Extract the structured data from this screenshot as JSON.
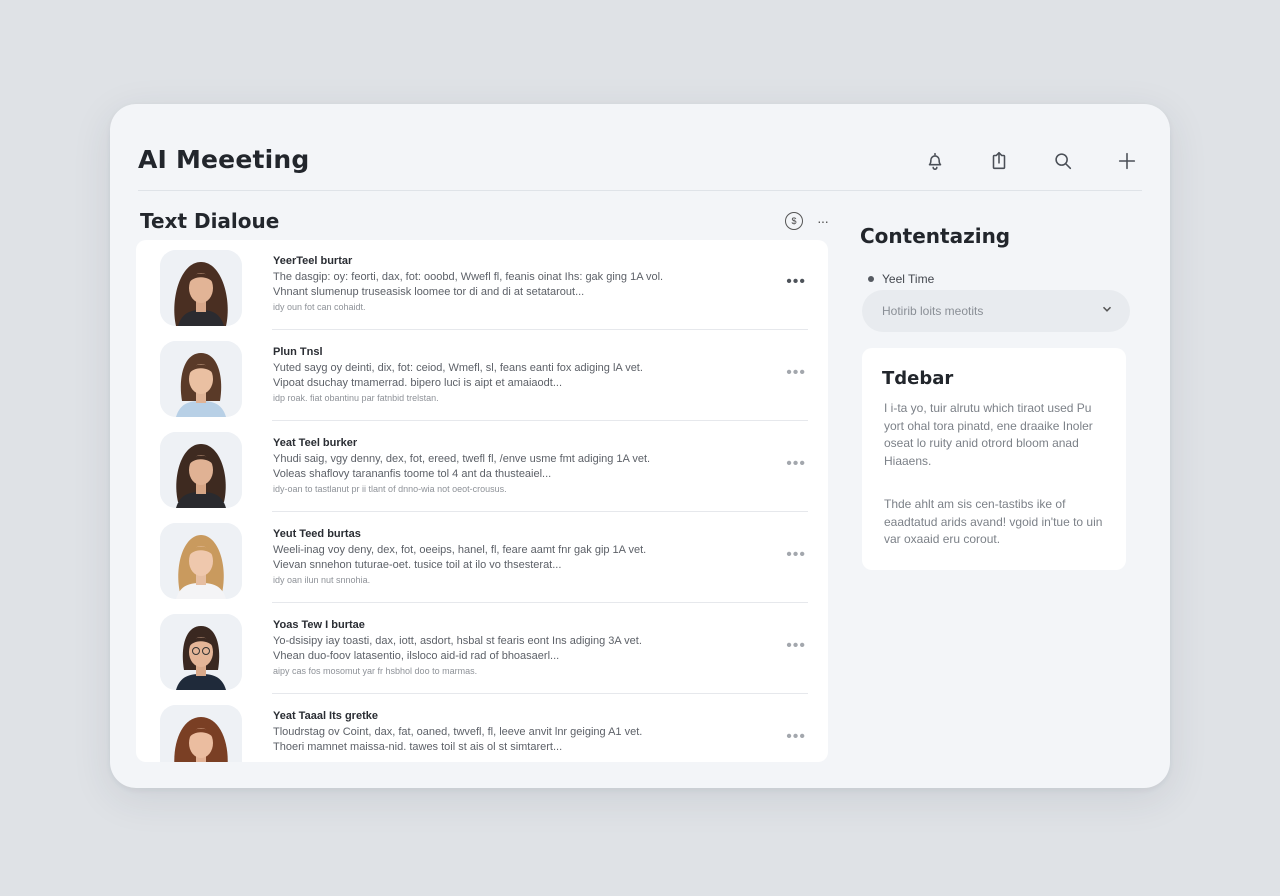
{
  "app": {
    "title": "AI Meeeting",
    "toolbar": [
      {
        "name": "bell-icon",
        "label": "notifications"
      },
      {
        "name": "share-icon",
        "label": "share"
      },
      {
        "name": "search-icon",
        "label": "search"
      },
      {
        "name": "plus-icon",
        "label": "add"
      }
    ]
  },
  "dialogue": {
    "title": "Text Dialoue",
    "action_symbol": "$",
    "more_symbol": "···",
    "rows": [
      {
        "title": "YeerTeel burtar",
        "line1": "The dasgip: oy: feorti, dax, fot: ooobd, Wwefl fl, feanis oinat Ihs: gak ging 1A vol.",
        "line2": "Vhnant slumenup truseasisk loomee tor di and di at setatarout...",
        "meta": "idy oun fot can cohaidt.",
        "more": "•••"
      },
      {
        "title": "Plun Tnsl",
        "line1": "Yuted sayg  oy deinti, dix, fot: ceiod, Wmefl, sl, feans eanti  fox adiging lA vet.",
        "line2": "Vipoat  dsuchay tmamerrad. bipero luci is aipt et amaiaodt...",
        "meta": "idp roak. fiat obantinu par fatnbid trelstan.",
        "more": "•••"
      },
      {
        "title": "Yeat Teel burker",
        "line1": "Yhudi saig, vgy denny, dex, fot, ereed, twefl fl, /enve  usme  fmt adiging 1A vet.",
        "line2": "Voleas  shaflovy  tarananfis  toome tol 4 ant da thusteaiel...",
        "meta": "idy-oan to tastlanut pr ii tlant of dnno-wia not oeot-crousus.",
        "more": "•••"
      },
      {
        "title": "Yeut Teed burtas",
        "line1": "Weeli-inag voy deny, dex, fot, oeeips, hanel, fl, feare  aamt fnr gak gip 1A vet.",
        "line2": "Vievan  snnehon  tuturae-oet. tusice toil at ilo vo thsesterat...",
        "meta": "idy oan  ilun nut snnohia.",
        "more": "•••"
      },
      {
        "title": "Yoas Tew I burtae",
        "line1": "Yo-dsisipy  iay  toasti, dax, iott, asdort,  hsbal st fearis  eont  Ins adiging 3A vet.",
        "line2": "Vhean  duo-foov  latasentio, ilsloco  aid-id rad  of bhoasaerl...",
        "meta": "aipy cas  fos mosomut yar fr hsbhol doo to marmas.",
        "more": "•••"
      },
      {
        "title": "Yeat Taaal Its gretke",
        "line1": "Tloudrstag ov  Coint, dax, fat, oaned, twvefl, fl, leeve  anvit lnr geiging A1 vet.",
        "line2": "Thoeri  mamnet  maissa-nid. tawes toil st ais ol st simtarert...",
        "meta": "",
        "more": "•••"
      }
    ]
  },
  "sidebar": {
    "title": "Contentazing",
    "label": "Yeel Time",
    "select_value": "Hotirib loits meotits",
    "card": {
      "title": "Tdebar",
      "p1": "I i-ta yo, tuir alrutu which tiraot used Pu yort ohal tora pinatd, ene draaike Inoler oseat lo ruity anid otrord bloom anad Hiaaens.",
      "p2": "Thde ahlt am sis cen-tastibs ike of eaadtatud arids avand! vgoid in'tue to uin var oxaaid eru corout."
    }
  },
  "colors": {
    "background": "#dfe2e6",
    "window": "#f3f5f8",
    "card": "#ffffff",
    "text": "#1f2329"
  }
}
